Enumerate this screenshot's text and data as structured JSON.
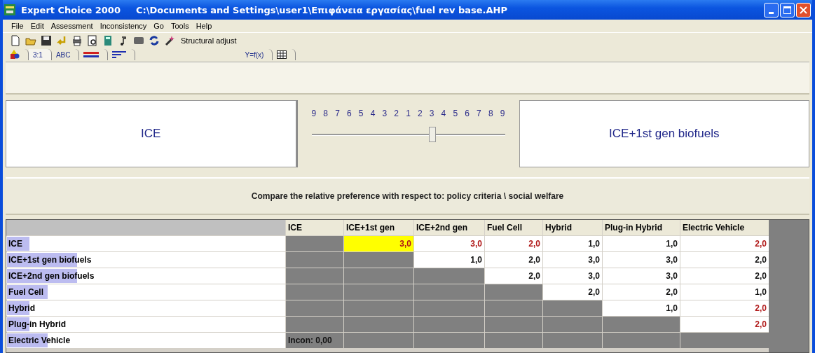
{
  "window": {
    "app": "Expert Choice 2000",
    "path": "C:\\Documents and Settings\\user1\\Επιφάνεια εργασίας\\fuel rev base.AHP"
  },
  "menu": [
    "File",
    "Edit",
    "Assessment",
    "Inconsistency",
    "Go",
    "Tools",
    "Help"
  ],
  "toolbar": {
    "button": "Structural adjust"
  },
  "tabs": [
    {
      "kind": "icon",
      "selected": false
    },
    {
      "kind": "text",
      "label": "3:1",
      "selected": true
    },
    {
      "kind": "text",
      "label": "ABC",
      "selected": false
    },
    {
      "kind": "lines",
      "selected": false
    },
    {
      "kind": "bars",
      "selected": false
    },
    {
      "kind": "text",
      "label": "Y=f(x)",
      "selected": false
    },
    {
      "kind": "grid",
      "selected": false
    }
  ],
  "comparison": {
    "left": "ICE",
    "right": "ICE+1st gen biofuels",
    "scale": [
      "9",
      "8",
      "7",
      "6",
      "5",
      "4",
      "3",
      "2",
      "1",
      "2",
      "3",
      "4",
      "5",
      "6",
      "7",
      "8",
      "9"
    ],
    "slider": {
      "level": 0.625
    }
  },
  "message": "Compare the relative preference  with respect to: policy criteria \\ social welfare",
  "table": {
    "columns": [
      "ICE",
      "ICE+1st gen",
      "ICE+2nd gen",
      "Fuel Cell",
      "Hybrid",
      "Plug-in Hybrid",
      "Electric Vehicle"
    ],
    "rows": [
      {
        "label": "ICE",
        "level": 0.08,
        "cells": [
          {
            "kind": "blank"
          },
          {
            "kind": "value",
            "value": "3,0",
            "inverse": true,
            "selected": true
          },
          {
            "kind": "value",
            "value": "3,0",
            "inverse": true,
            "selected": false
          },
          {
            "kind": "value",
            "value": "2,0",
            "inverse": true,
            "selected": false
          },
          {
            "kind": "value",
            "value": "1,0",
            "inverse": false,
            "selected": false
          },
          {
            "kind": "value",
            "value": "1,0",
            "inverse": false,
            "selected": false
          },
          {
            "kind": "value",
            "value": "2,0",
            "inverse": true,
            "selected": false
          }
        ]
      },
      {
        "label": "ICE+1st gen biofuels",
        "level": 0.25,
        "cells": [
          {
            "kind": "blank"
          },
          {
            "kind": "blank"
          },
          {
            "kind": "value",
            "value": "1,0",
            "inverse": false,
            "selected": false
          },
          {
            "kind": "value",
            "value": "2,0",
            "inverse": false,
            "selected": false
          },
          {
            "kind": "value",
            "value": "3,0",
            "inverse": false,
            "selected": false
          },
          {
            "kind": "value",
            "value": "3,0",
            "inverse": false,
            "selected": false
          },
          {
            "kind": "value",
            "value": "2,0",
            "inverse": false,
            "selected": false
          }
        ]
      },
      {
        "label": "ICE+2nd gen biofuels",
        "level": 0.25,
        "cells": [
          {
            "kind": "blank"
          },
          {
            "kind": "blank"
          },
          {
            "kind": "blank"
          },
          {
            "kind": "value",
            "value": "2,0",
            "inverse": false,
            "selected": false
          },
          {
            "kind": "value",
            "value": "3,0",
            "inverse": false,
            "selected": false
          },
          {
            "kind": "value",
            "value": "3,0",
            "inverse": false,
            "selected": false
          },
          {
            "kind": "value",
            "value": "2,0",
            "inverse": false,
            "selected": false
          }
        ]
      },
      {
        "label": "Fuel Cell",
        "level": 0.145,
        "cells": [
          {
            "kind": "blank"
          },
          {
            "kind": "blank"
          },
          {
            "kind": "blank"
          },
          {
            "kind": "blank"
          },
          {
            "kind": "value",
            "value": "2,0",
            "inverse": false,
            "selected": false
          },
          {
            "kind": "value",
            "value": "2,0",
            "inverse": false,
            "selected": false
          },
          {
            "kind": "value",
            "value": "1,0",
            "inverse": false,
            "selected": false
          }
        ]
      },
      {
        "label": "Hybrid",
        "level": 0.08,
        "cells": [
          {
            "kind": "blank"
          },
          {
            "kind": "blank"
          },
          {
            "kind": "blank"
          },
          {
            "kind": "blank"
          },
          {
            "kind": "blank"
          },
          {
            "kind": "value",
            "value": "1,0",
            "inverse": false,
            "selected": false
          },
          {
            "kind": "value",
            "value": "2,0",
            "inverse": true,
            "selected": false
          }
        ]
      },
      {
        "label": "Plug-in Hybrid",
        "level": 0.08,
        "cells": [
          {
            "kind": "blank"
          },
          {
            "kind": "blank"
          },
          {
            "kind": "blank"
          },
          {
            "kind": "blank"
          },
          {
            "kind": "blank"
          },
          {
            "kind": "blank"
          },
          {
            "kind": "value",
            "value": "2,0",
            "inverse": true,
            "selected": false
          }
        ]
      },
      {
        "label": "Electric Vehicle",
        "level": 0.145,
        "cells": [
          {
            "kind": "note",
            "text": "Incon: 0,00"
          },
          {
            "kind": "blank"
          },
          {
            "kind": "blank"
          },
          {
            "kind": "blank"
          },
          {
            "kind": "blank"
          },
          {
            "kind": "blank"
          },
          {
            "kind": "blank"
          }
        ]
      }
    ]
  }
}
